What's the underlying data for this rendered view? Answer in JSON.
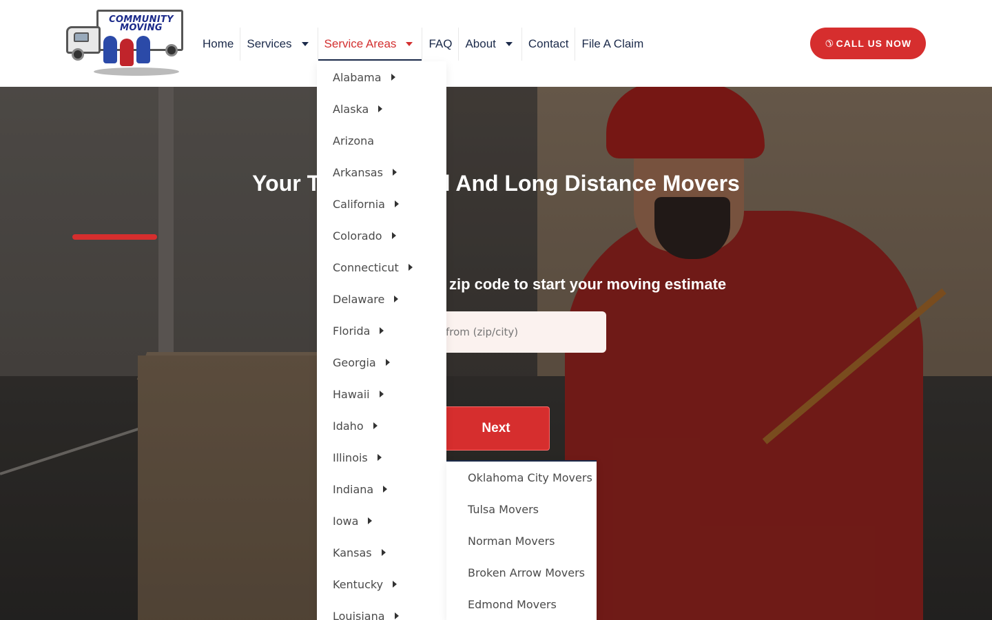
{
  "header": {
    "logo": {
      "line1": "COMMUNITY",
      "line2": "MOVING"
    },
    "nav": [
      {
        "label": "Home",
        "has_caret": false,
        "active": false
      },
      {
        "label": "Services",
        "has_caret": true,
        "active": false
      },
      {
        "label": "Service Areas",
        "has_caret": true,
        "active": true
      },
      {
        "label": "FAQ",
        "has_caret": false,
        "active": false
      },
      {
        "label": "About",
        "has_caret": true,
        "active": false
      },
      {
        "label": "Contact",
        "has_caret": false,
        "active": false
      },
      {
        "label": "File A Claim",
        "has_caret": false,
        "active": false
      }
    ],
    "cta": {
      "label": "CALL US NOW",
      "icon": "phone-icon"
    }
  },
  "hero": {
    "title": "Your Trusted Local And Long Distance Movers",
    "estimate_label": "Enter your zip code to start your moving estimate",
    "input_placeholder": "Moving from (zip/city)",
    "next_label": "Next"
  },
  "service_areas_dropdown": {
    "items": [
      {
        "label": "Alabama",
        "has_sub": true
      },
      {
        "label": "Alaska",
        "has_sub": true
      },
      {
        "label": "Arizona",
        "has_sub": false
      },
      {
        "label": "Arkansas",
        "has_sub": true
      },
      {
        "label": "California",
        "has_sub": true
      },
      {
        "label": "Colorado",
        "has_sub": true
      },
      {
        "label": "Connecticut",
        "has_sub": true
      },
      {
        "label": "Delaware",
        "has_sub": true
      },
      {
        "label": "Florida",
        "has_sub": true
      },
      {
        "label": "Georgia",
        "has_sub": true
      },
      {
        "label": "Hawaii",
        "has_sub": true
      },
      {
        "label": "Idaho",
        "has_sub": true
      },
      {
        "label": "Illinois",
        "has_sub": true
      },
      {
        "label": "Indiana",
        "has_sub": true
      },
      {
        "label": "Iowa",
        "has_sub": true
      },
      {
        "label": "Kansas",
        "has_sub": true
      },
      {
        "label": "Kentucky",
        "has_sub": true
      },
      {
        "label": "Louisiana",
        "has_sub": true
      }
    ]
  },
  "oklahoma_submenu": {
    "items": [
      "Oklahoma City Movers",
      "Tulsa Movers",
      "Norman Movers",
      "Broken Arrow Movers",
      "Edmond Movers"
    ]
  },
  "colors": {
    "brand_red": "#d62e2e",
    "nav_text": "#1b2a4a",
    "active_nav": "#d32f2f"
  }
}
